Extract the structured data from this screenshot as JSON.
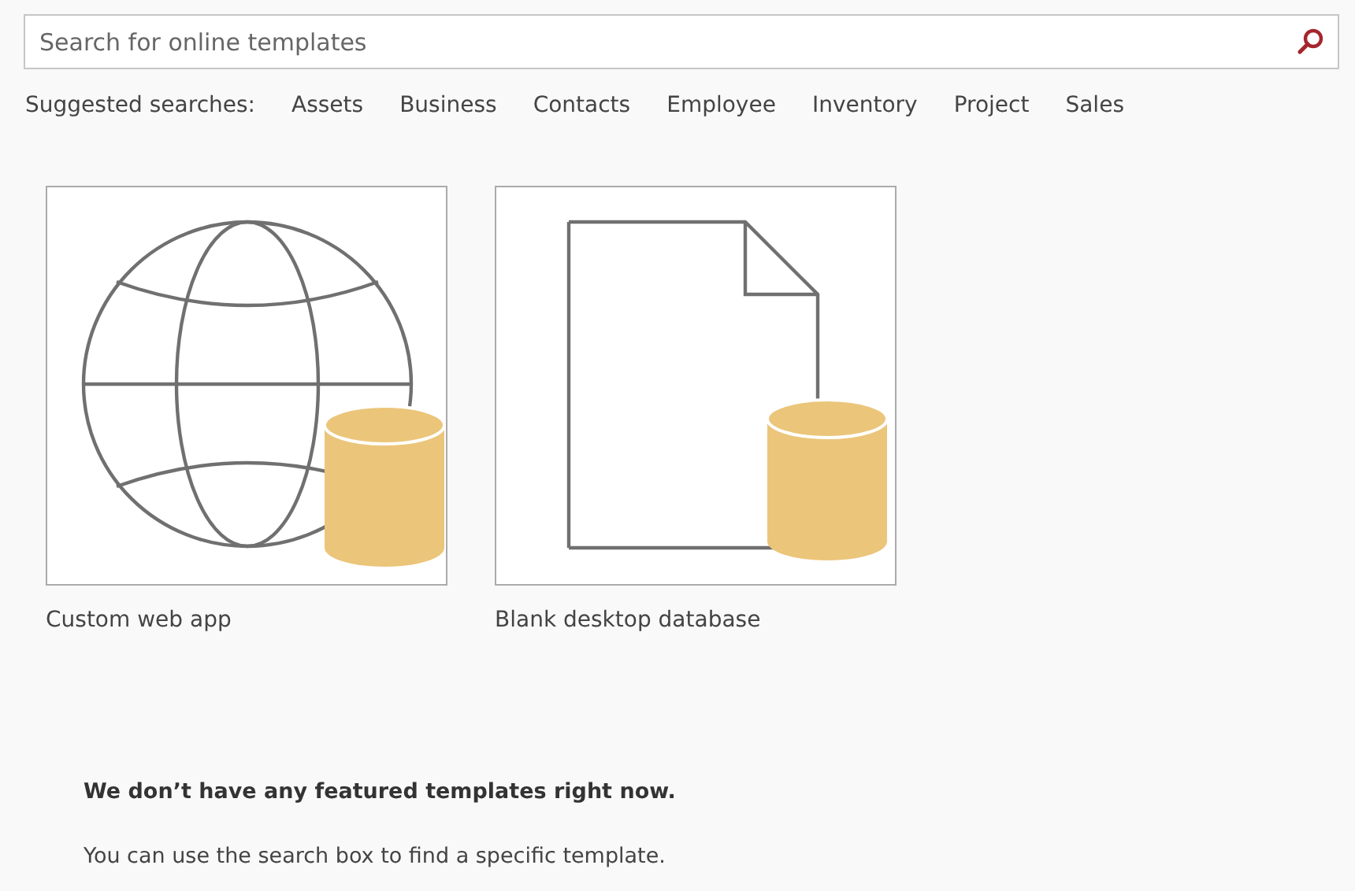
{
  "search": {
    "placeholder": "Search for online templates"
  },
  "suggested_searches": {
    "label": "Suggested searches:",
    "items": [
      "Assets",
      "Business",
      "Contacts",
      "Employee",
      "Inventory",
      "Project",
      "Sales"
    ]
  },
  "templates": [
    {
      "kind": "web",
      "label": "Custom web app"
    },
    {
      "kind": "desktop",
      "label": "Blank desktop database"
    }
  ],
  "message": {
    "heading": "We don’t have any featured templates right now.",
    "text": "You can use the search box to find a specific template."
  }
}
